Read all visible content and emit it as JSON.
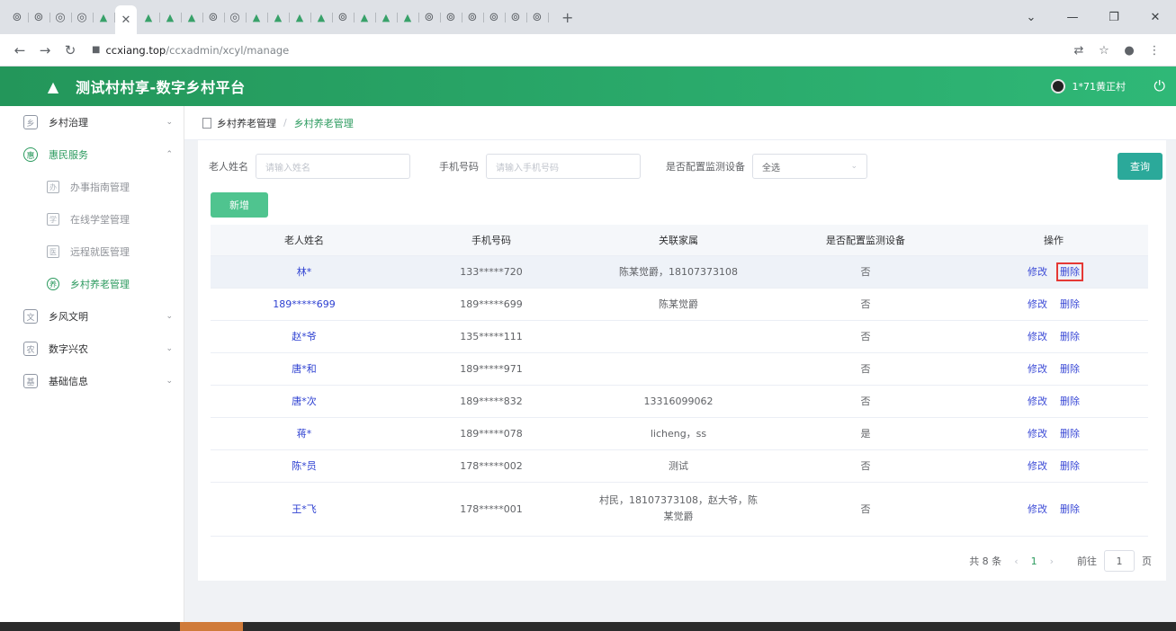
{
  "browser": {
    "tabs": [
      "⊚",
      "⊚",
      "◎",
      "◎",
      "▲",
      "✕",
      "▲",
      "▲",
      "▲",
      "⊚",
      "◎",
      "▲",
      "▲",
      "▲",
      "▲",
      "⊚",
      "▲",
      "▲",
      "▲",
      "⊚",
      "⊚",
      "⊚",
      "⊚",
      "⊚",
      "⊚"
    ],
    "url_host": "ccxiang.top",
    "url_path": "/ccxadmin/xcyl/manage"
  },
  "app": {
    "title": "测试村村享-数字乡村平台",
    "user_name": "1*71黄正村"
  },
  "sidebar": {
    "items": [
      {
        "label": "乡村治理",
        "icon": "乡"
      },
      {
        "label": "惠民服务",
        "icon": "惠"
      },
      {
        "label": "乡风文明",
        "icon": "文"
      },
      {
        "label": "数字兴农",
        "icon": "农"
      },
      {
        "label": "基础信息",
        "icon": "基"
      }
    ],
    "subitems": [
      {
        "label": "办事指南管理",
        "icon": "办"
      },
      {
        "label": "在线学堂管理",
        "icon": "学"
      },
      {
        "label": "远程就医管理",
        "icon": "医"
      },
      {
        "label": "乡村养老管理",
        "icon": "养"
      }
    ]
  },
  "breadcrumb": {
    "parent": "乡村养老管理",
    "current": "乡村养老管理"
  },
  "filters": {
    "name_label": "老人姓名",
    "name_placeholder": "请输入姓名",
    "phone_label": "手机号码",
    "phone_placeholder": "请输入手机号码",
    "device_label": "是否配置监测设备",
    "device_value": "全选",
    "query_button": "查询",
    "add_button": "新增"
  },
  "table": {
    "headers": [
      "老人姓名",
      "手机号码",
      "关联家属",
      "是否配置监测设备",
      "操作"
    ],
    "edit_label": "修改",
    "delete_label": "删除",
    "rows": [
      {
        "name": "林*",
        "phone": "133*****720",
        "family": "陈某觉爵，18107373108",
        "device": "否"
      },
      {
        "name": "189*****699",
        "phone": "189*****699",
        "family": "陈某觉爵",
        "device": "否"
      },
      {
        "name": "赵*爷",
        "phone": "135*****111",
        "family": "",
        "device": "否"
      },
      {
        "name": "唐*和",
        "phone": "189*****971",
        "family": "",
        "device": "否"
      },
      {
        "name": "唐*次",
        "phone": "189*****832",
        "family": "13316099062",
        "device": "否"
      },
      {
        "name": "蒋*",
        "phone": "189*****078",
        "family": "licheng，ss",
        "device": "是"
      },
      {
        "name": "陈*员",
        "phone": "178*****002",
        "family": "测试",
        "device": "否"
      },
      {
        "name": "王*飞",
        "phone": "178*****001",
        "family": "村民，18107373108，赵大爷，陈某觉爵",
        "device": "否"
      }
    ]
  },
  "pagination": {
    "total": "共 8 条",
    "page": "1",
    "goto_label": "前往",
    "goto_value": "1",
    "page_unit": "页"
  }
}
